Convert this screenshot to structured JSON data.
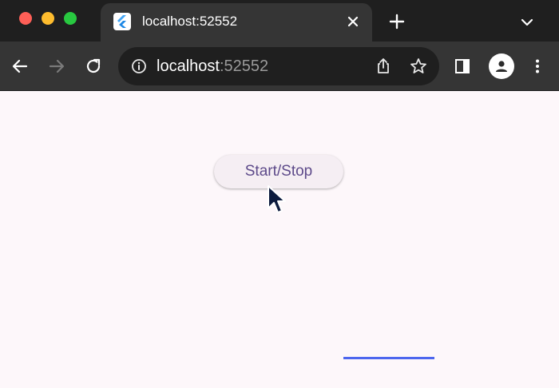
{
  "browser": {
    "tab": {
      "title": "localhost:52552"
    },
    "url": {
      "host": "localhost",
      "port": ":52552"
    },
    "icons": {
      "close": "close-icon",
      "new_tab": "plus-icon",
      "tab_menu": "chevron-down-icon",
      "back": "arrow-left-icon",
      "forward": "arrow-right-icon",
      "reload": "reload-icon",
      "info": "info-icon",
      "share": "share-icon",
      "bookmark": "star-icon",
      "side_panel": "side-panel-icon",
      "profile": "profile-icon",
      "menu": "kebab-menu-icon"
    }
  },
  "app": {
    "button_label": "Start/Stop",
    "accent_color": "#4d66ee",
    "background_color": "#fdf7fa"
  }
}
